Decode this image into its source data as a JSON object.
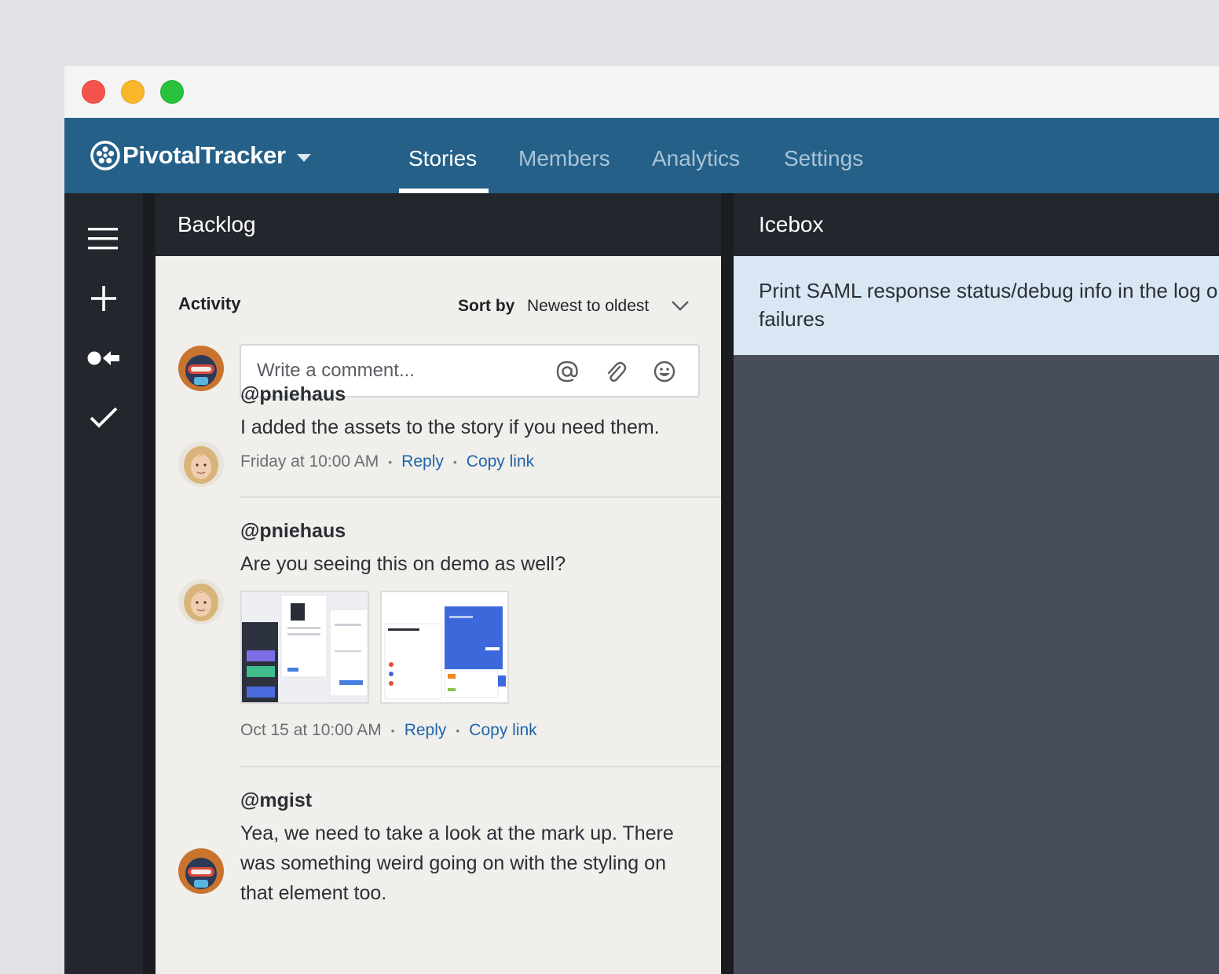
{
  "app": {
    "brand": "PivotalTracker",
    "tabs": [
      {
        "label": "Stories",
        "active": true
      },
      {
        "label": "Members",
        "active": false
      },
      {
        "label": "Analytics",
        "active": false
      },
      {
        "label": "Settings",
        "active": false
      }
    ],
    "colors": {
      "nav": "#256088",
      "sidebar": "#23262d",
      "link": "#1e64ad",
      "story_card": "#d9e7f4"
    }
  },
  "sidebar": {
    "icons": [
      "menu-icon",
      "add-icon",
      "story-type-icon",
      "checkmark-icon"
    ]
  },
  "backlog": {
    "title": "Backlog",
    "activity_label": "Activity",
    "sort_label": "Sort by",
    "sort_value": "Newest to oldest",
    "comment_placeholder": "Write a comment...",
    "comments": [
      {
        "user": "@pniehaus",
        "text": "I added the assets to the story if you need them.",
        "time": "Friday at 10:00 AM",
        "reply": "Reply",
        "copy": "Copy link"
      },
      {
        "user": "@pniehaus",
        "text": "Are you seeing this on demo as well?",
        "time": "Oct 15 at 10:00 AM",
        "reply": "Reply",
        "copy": "Copy link",
        "attachments": 2
      },
      {
        "user": "@mgist",
        "text": "Yea, we need to take a look at the mark up. There was something weird going on with the styling on that element too."
      }
    ]
  },
  "icebox": {
    "title": "Icebox",
    "story": "Print SAML response status/debug info in the log on failures"
  }
}
